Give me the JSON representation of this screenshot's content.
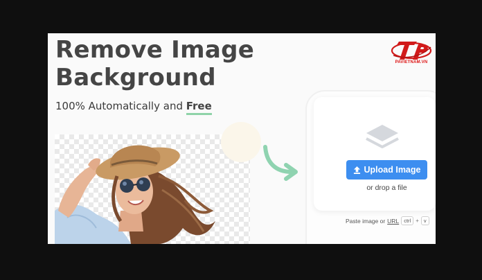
{
  "hero": {
    "title_line1": "Remove Image",
    "title_line2": "Background",
    "subtitle_prefix": "100% Automatically and ",
    "subtitle_emphasis": "Free"
  },
  "brand": {
    "logo_text": "PAVIETNAM.VN",
    "color": "#d11a1a"
  },
  "demo": {
    "arrow_icon": "curved-arrow-icon",
    "arrow_color": "#8fd3b0"
  },
  "upload": {
    "layers_icon": "layers-icon",
    "button_label": "Upload Image",
    "button_icon": "upload-icon",
    "button_color": "#3d8ef0",
    "drop_text": "or drop a file",
    "paste_prefix": "Paste image or",
    "paste_url": "URL",
    "key_ctrl": "ctrl",
    "key_plus": "+",
    "key_v": "v"
  }
}
